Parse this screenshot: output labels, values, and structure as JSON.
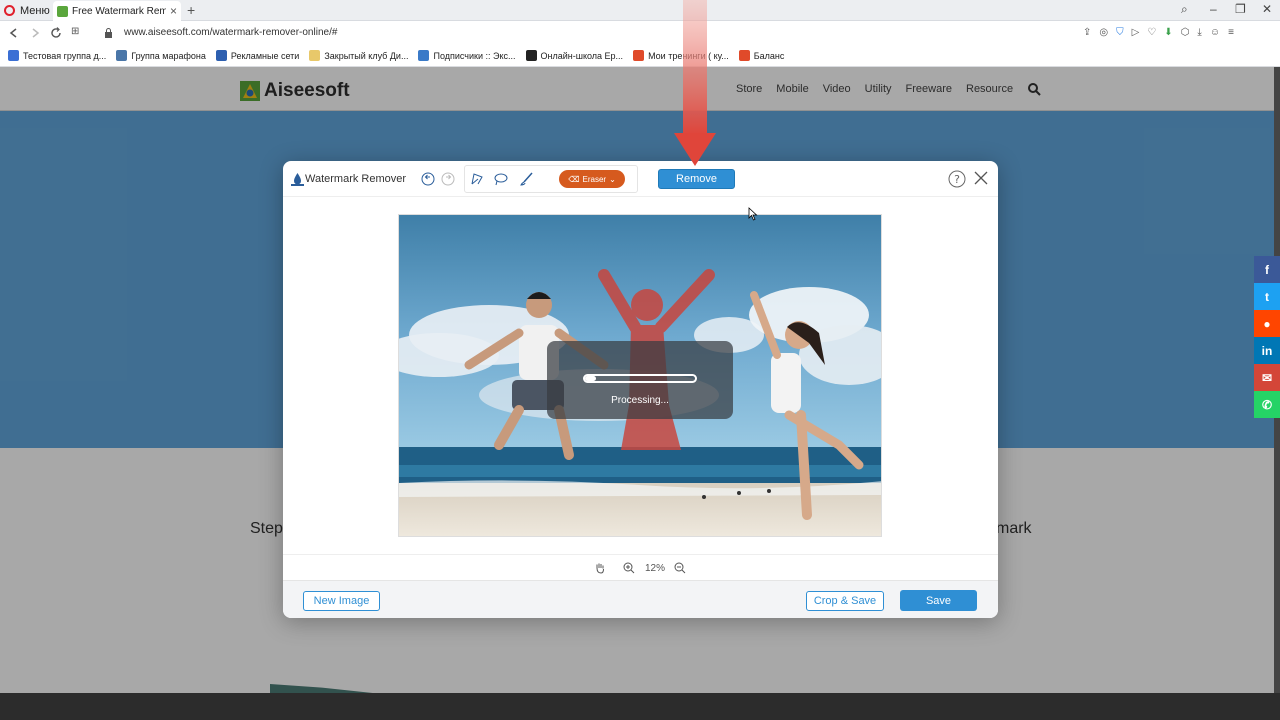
{
  "browser": {
    "menu_label": "Меню",
    "tab_title": "Free Watermark Remover -",
    "url": "www.aiseesoft.com/watermark-remover-online/#",
    "bookmarks": [
      {
        "label": "Тестовая группа д...",
        "color": "#3b6fd4"
      },
      {
        "label": "Группа марафона",
        "color": "#4a76a8"
      },
      {
        "label": "Рекламные сети",
        "color": "#2d5fb0"
      },
      {
        "label": "Закрытый клуб Ди...",
        "color": "#e8c86a"
      },
      {
        "label": "Подписчики :: Экс...",
        "color": "#3a7ac8"
      },
      {
        "label": "Онлайн-школа Ер...",
        "color": "#222222"
      },
      {
        "label": "Мои тренинги ( ку...",
        "color": "#e04a2a"
      },
      {
        "label": "Баланс",
        "color": "#e04a2a"
      }
    ]
  },
  "site": {
    "logo_text": "Aiseesoft",
    "nav": [
      "Store",
      "Mobile",
      "Video",
      "Utility",
      "Freeware",
      "Resource"
    ],
    "step_left": "Step",
    "step_right": "mark",
    "share_colors": [
      "#3b5998",
      "#1da1f2",
      "#ff4500",
      "#0077b5",
      "#d44638",
      "#25d366"
    ]
  },
  "dialog": {
    "title": "Watermark Remover",
    "eraser_label": "Eraser",
    "remove_label": "Remove",
    "processing_text": "Processing...",
    "processing_progress": 0.1,
    "zoom_level": "12%",
    "new_image_label": "New Image",
    "crop_save_label": "Crop & Save",
    "save_label": "Save"
  },
  "colors": {
    "accent": "#2f8fd4",
    "eraser": "#d65a1e",
    "arrow": "#e0453a"
  }
}
